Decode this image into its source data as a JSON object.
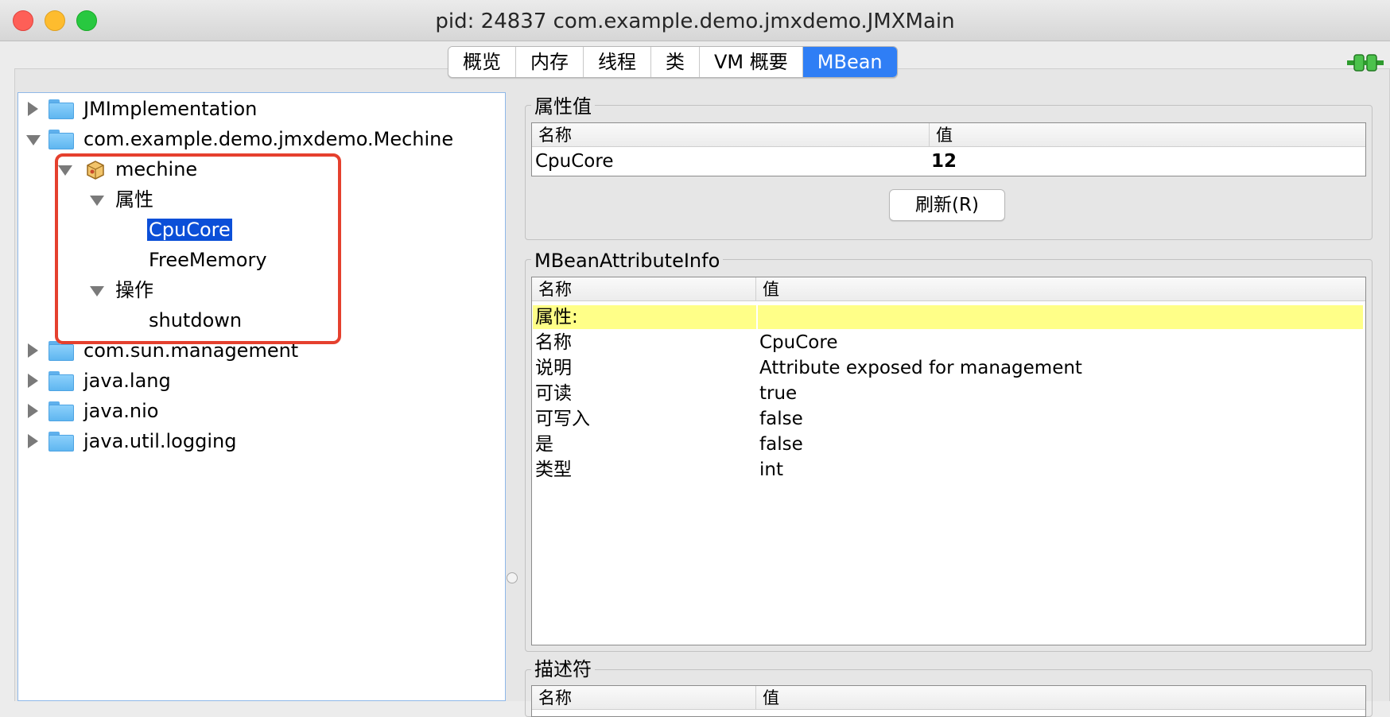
{
  "window": {
    "title": "pid: 24837 com.example.demo.jmxdemo.JMXMain"
  },
  "tabs": [
    {
      "label": "概览"
    },
    {
      "label": "内存"
    },
    {
      "label": "线程"
    },
    {
      "label": "类"
    },
    {
      "label": "VM 概要"
    },
    {
      "label": "MBean",
      "active": true
    }
  ],
  "tree": {
    "items": [
      {
        "label": "JMImplementation"
      },
      {
        "label": "com.example.demo.jmxdemo.Mechine"
      },
      {
        "label": "mechine"
      },
      {
        "label": "属性"
      },
      {
        "label": "CpuCore",
        "selected": true
      },
      {
        "label": "FreeMemory"
      },
      {
        "label": "操作"
      },
      {
        "label": "shutdown"
      },
      {
        "label": "com.sun.management"
      },
      {
        "label": "java.lang"
      },
      {
        "label": "java.nio"
      },
      {
        "label": "java.util.logging"
      }
    ]
  },
  "attr_values": {
    "title": "属性值",
    "col_name": "名称",
    "col_value": "值",
    "row_name": "CpuCore",
    "row_value": "12",
    "refresh_label": "刷新(R)"
  },
  "attr_info": {
    "title": "MBeanAttributeInfo",
    "col_name": "名称",
    "col_value": "值",
    "rows": [
      {
        "name": "属性:",
        "value": ""
      },
      {
        "name": "名称",
        "value": "CpuCore"
      },
      {
        "name": "说明",
        "value": "Attribute exposed for management"
      },
      {
        "name": "可读",
        "value": "true"
      },
      {
        "name": "可写入",
        "value": "false"
      },
      {
        "name": "是",
        "value": "false"
      },
      {
        "name": "类型",
        "value": "int"
      }
    ]
  },
  "descriptor": {
    "title": "描述符",
    "col_name": "名称",
    "col_value": "值"
  },
  "colors": {
    "tab_active": "#2f7ef5",
    "selection": "#0b4fd8",
    "highlight_border": "#e5402e",
    "section_header_row": "#ffff88"
  }
}
